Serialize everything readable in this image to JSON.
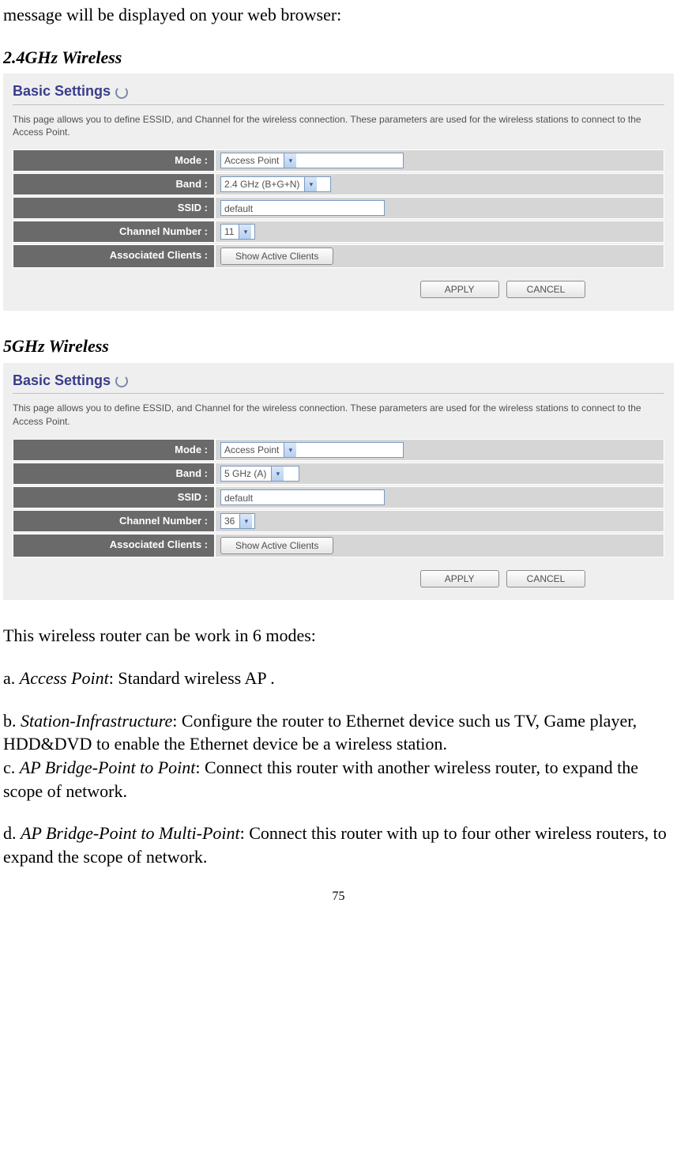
{
  "intro_line": "message will be displayed on your web browser:",
  "sections": {
    "s1": {
      "heading": "2.4GHz Wireless"
    },
    "s2": {
      "heading": "5GHz Wireless"
    }
  },
  "panel": {
    "title": "Basic Settings",
    "desc": "This page allows you to define ESSID, and Channel for the wireless connection. These parameters are used for the wireless stations to connect to the Access Point.",
    "labels": {
      "mode": "Mode :",
      "band": "Band :",
      "ssid": "SSID :",
      "channel": "Channel Number :",
      "clients": "Associated Clients :"
    },
    "show_clients": "Show Active Clients",
    "apply": "APPLY",
    "cancel": "CANCEL"
  },
  "values24": {
    "mode": "Access Point",
    "band": "2.4 GHz (B+G+N)",
    "ssid": "default",
    "channel": "11"
  },
  "values5": {
    "mode": "Access Point",
    "band": "5 GHz (A)",
    "ssid": "default",
    "channel": "36"
  },
  "body": {
    "modes_intro": "This wireless router can be work in 6 modes:",
    "a_term": "Access Point",
    "a_text": ": Standard wireless AP .",
    "b_term": "Station-Infrastructure",
    "b_text": ": Configure the router to Ethernet device such us TV, Game player, HDD&DVD to enable the Ethernet device be a wireless station.",
    "c_term": "AP Bridge-Point to Point",
    "c_text": ": Connect this router with another wireless router, to expand the scope of network.",
    "d_term": "AP Bridge-Point to Multi-Point",
    "d_text": ": Connect this router with up to four other wireless routers, to expand the scope of network."
  },
  "page_number": "75"
}
